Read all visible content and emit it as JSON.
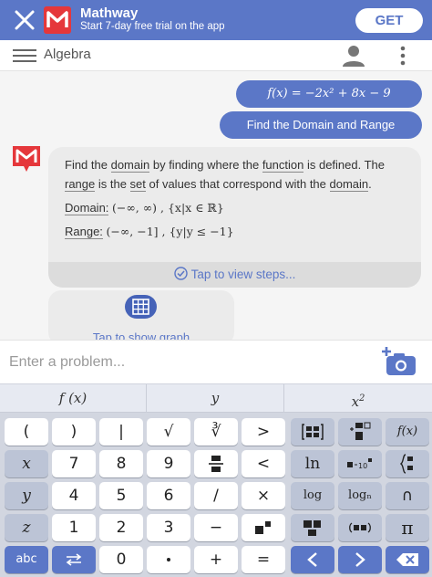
{
  "banner": {
    "app_name": "Mathway",
    "subtitle": "Start 7-day free trial on the app",
    "get_label": "GET"
  },
  "header": {
    "title": "Algebra"
  },
  "chat": {
    "user_messages": [
      "f(x) = −2x² + 8x − 9",
      "Find the Domain and Range"
    ],
    "answer": {
      "p1_a": "Find the ",
      "p1_link1": "domain",
      "p1_b": " by finding where the ",
      "p1_link2": "function",
      "p1_c": " is defined. The ",
      "p1_link3": "range",
      "p1_d": " is the ",
      "p1_link4": "set",
      "p1_e": " of values that correspond with the ",
      "p1_link5": "domain",
      "p1_f": ".",
      "domain_label": "Domain:",
      "domain_value": "(−∞, ∞) , {x|x ∈ ℝ}",
      "range_label": "Range:",
      "range_value": "(−∞, −1] , {y|y ≤ −1}",
      "steps_label": "Tap to view steps..."
    },
    "graph_label": "Tap to show graph"
  },
  "input": {
    "placeholder": "Enter a problem..."
  },
  "function_tabs": [
    "f (x)",
    "y",
    "x²"
  ],
  "keys": {
    "row1": [
      "(",
      ")",
      "|",
      "√",
      "∛",
      ">"
    ],
    "row2": [
      "x",
      "7",
      "8",
      "9",
      "<"
    ],
    "row3": [
      "y",
      "4",
      "5",
      "6",
      "/",
      "×",
      "log",
      "logₙ",
      "∩"
    ],
    "row4": [
      "z",
      "1",
      "2",
      "3",
      "−",
      "π"
    ],
    "row5": [
      "abc",
      "0",
      "+",
      "=",
      "ln"
    ],
    "fx": "f(x)",
    "ln": "ln"
  }
}
